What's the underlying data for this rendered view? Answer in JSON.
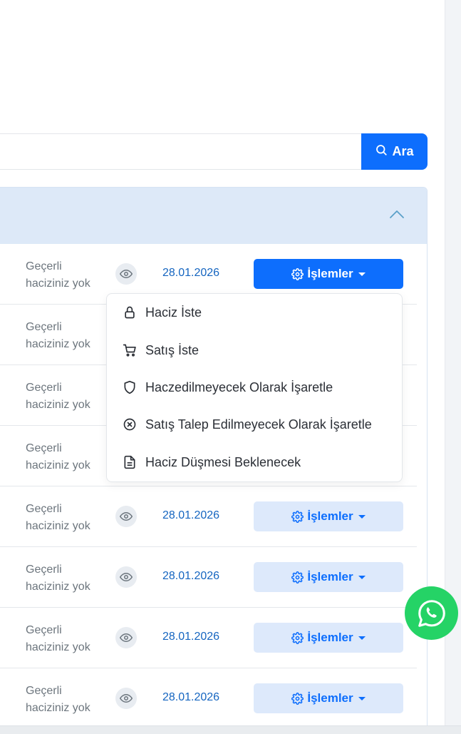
{
  "search": {
    "placeholder": "",
    "button_label": "Ara"
  },
  "rows": [
    {
      "status_line1": "Geçerli",
      "status_line2": "haciziniz yok",
      "date": "28.01.2026",
      "actions_label": "İşlemler"
    },
    {
      "status_line1": "Geçerli",
      "status_line2": "haciziniz yok"
    },
    {
      "status_line1": "Geçerli",
      "status_line2": "haciziniz yok"
    },
    {
      "status_line1": "Geçerli",
      "status_line2": "haciziniz yok"
    },
    {
      "status_line1": "Geçerli",
      "status_line2": "haciziniz yok",
      "date": "28.01.2026",
      "actions_label": "İşlemler"
    },
    {
      "status_line1": "Geçerli",
      "status_line2": "haciziniz yok",
      "date": "28.01.2026",
      "actions_label": "İşlemler"
    },
    {
      "status_line1": "Geçerli",
      "status_line2": "haciziniz yok",
      "date": "28.01.2026",
      "actions_label": "İşlemler"
    },
    {
      "status_line1": "Geçerli",
      "status_line2": "haciziniz yok",
      "date": "28.01.2026",
      "actions_label": "İşlemler"
    }
  ],
  "dropdown": {
    "items": [
      {
        "label": "Haciz İste",
        "icon": "lock-icon"
      },
      {
        "label": "Satış İste",
        "icon": "cart-icon"
      },
      {
        "label": "Haczedilmeyecek Olarak İşaretle",
        "icon": "shield-icon"
      },
      {
        "label": "Satış Talep Edilmeyecek Olarak İşaretle",
        "icon": "x-circle-icon"
      },
      {
        "label": "Haciz Düşmesi Beklenecek",
        "icon": "document-icon"
      }
    ]
  },
  "colors": {
    "primary": "#0d6efd",
    "header_bg": "#dde9f8",
    "date_text": "#1565c0",
    "whatsapp": "#25d366"
  }
}
